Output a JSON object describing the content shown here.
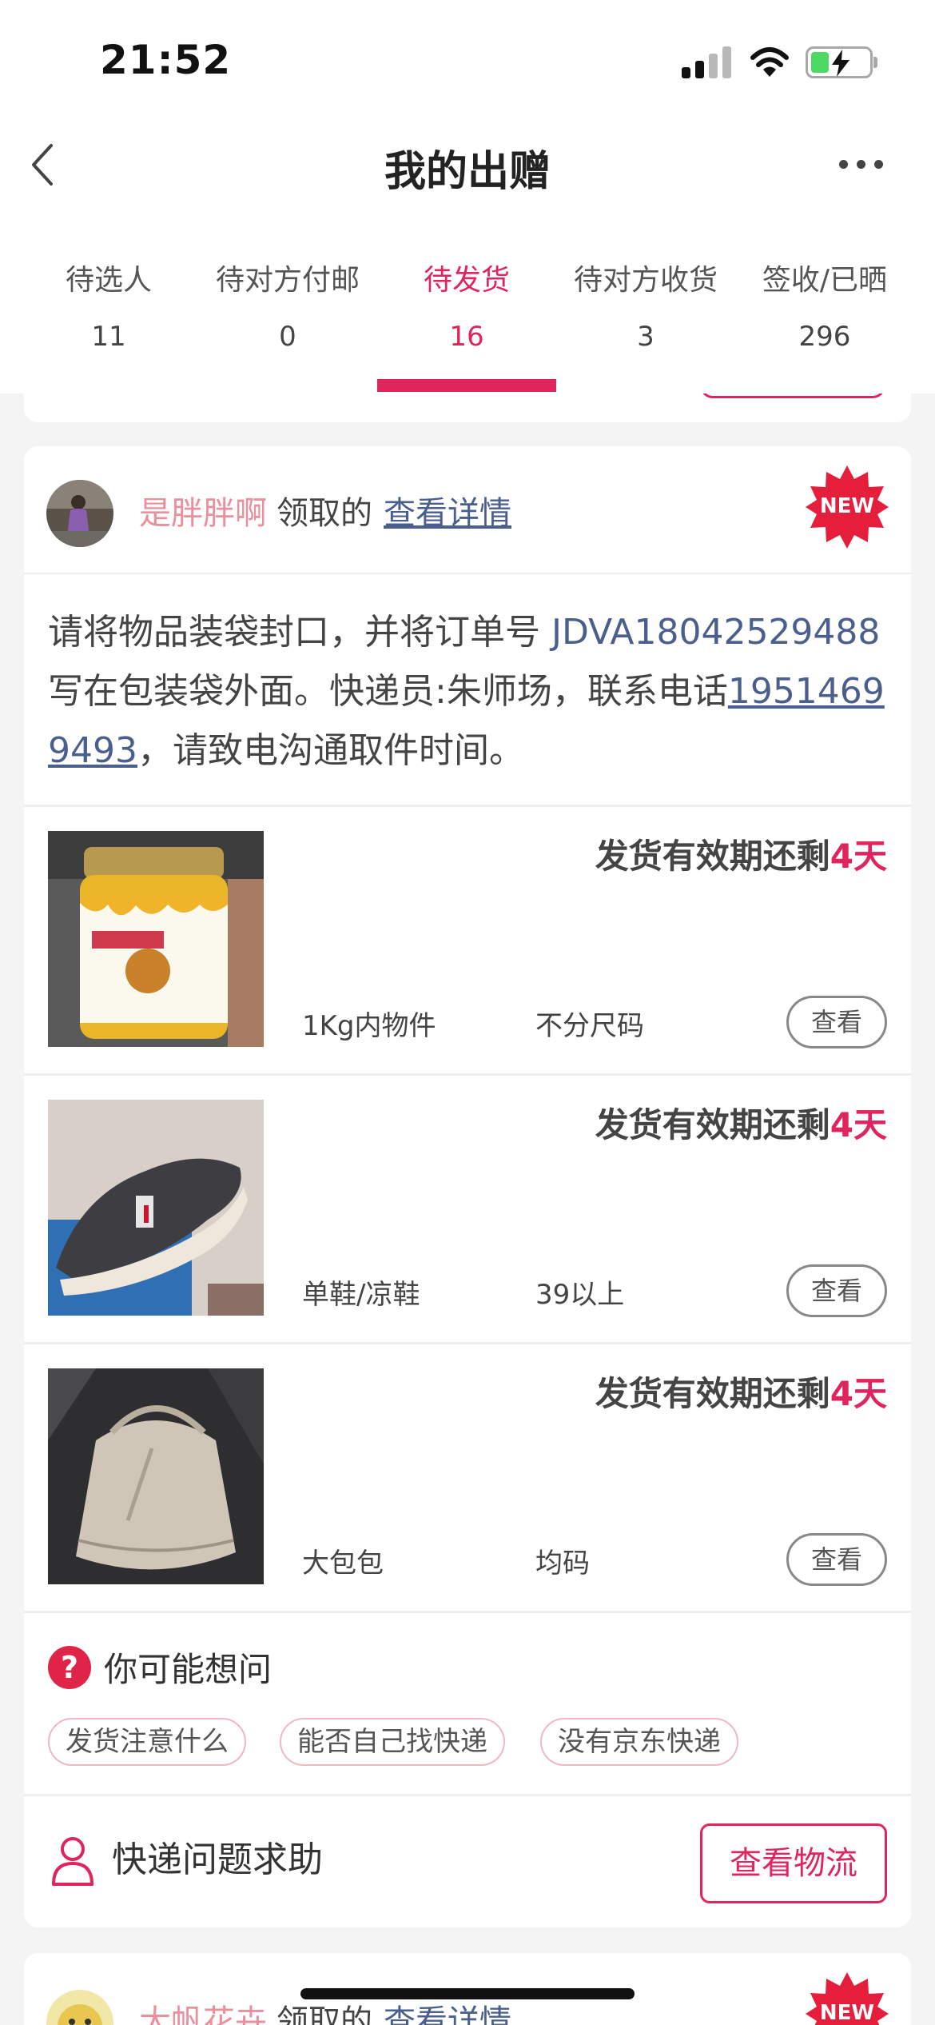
{
  "status_bar": {
    "time": "21:52",
    "battery_fill_fraction": 0.3,
    "charging": true
  },
  "nav": {
    "title": "我的出赠"
  },
  "tabs": [
    {
      "label": "待选人",
      "count": "11"
    },
    {
      "label": "待对方付邮",
      "count": "0"
    },
    {
      "label": "待发货",
      "count": "16",
      "active": true
    },
    {
      "label": "待对方收货",
      "count": "3"
    },
    {
      "label": "签收/已晒",
      "count": "296"
    }
  ],
  "colors": {
    "accent": "#e0245e",
    "link": "#4a5f8e",
    "giver_name": "#ea8f9c"
  },
  "card": {
    "giver_name": "是胖胖啊",
    "received_text": "领取的",
    "detail_link": "查看详情",
    "new_badge": "NEW",
    "instruction_prefix": "请将物品装袋封口，并将订单号 ",
    "order_number": "JDVA18042529488",
    "instruction_middle": " 写在包装袋外面。快递员:朱师场，联系电话",
    "phone": "19514699493",
    "instruction_suffix": "，请致电沟通取件时间。",
    "items": [
      {
        "deadline_prefix": "发货有效期还剩",
        "deadline_days": "4天",
        "category": "1Kg内物件",
        "size": "不分尺码",
        "view_label": "查看",
        "thumb": "honey-jar-image"
      },
      {
        "deadline_prefix": "发货有效期还剩",
        "deadline_days": "4天",
        "category": "单鞋/凉鞋",
        "size": "39以上",
        "view_label": "查看",
        "thumb": "shoe-image"
      },
      {
        "deadline_prefix": "发货有效期还剩",
        "deadline_days": "4天",
        "category": "大包包",
        "size": "均码",
        "view_label": "查看",
        "thumb": "bag-image"
      }
    ],
    "faq": {
      "icon": "question-icon",
      "title": "你可能想问",
      "chips": [
        "发货注意什么",
        "能否自己找快递",
        "没有京东快递"
      ]
    },
    "help": {
      "icon": "person-icon",
      "text": "快递问题求助",
      "button": "查看物流"
    }
  },
  "next_card": {
    "giver_name": "大帆花卉",
    "received_text": "领取的",
    "detail_link": "查看详情",
    "new_badge": "NEW"
  }
}
